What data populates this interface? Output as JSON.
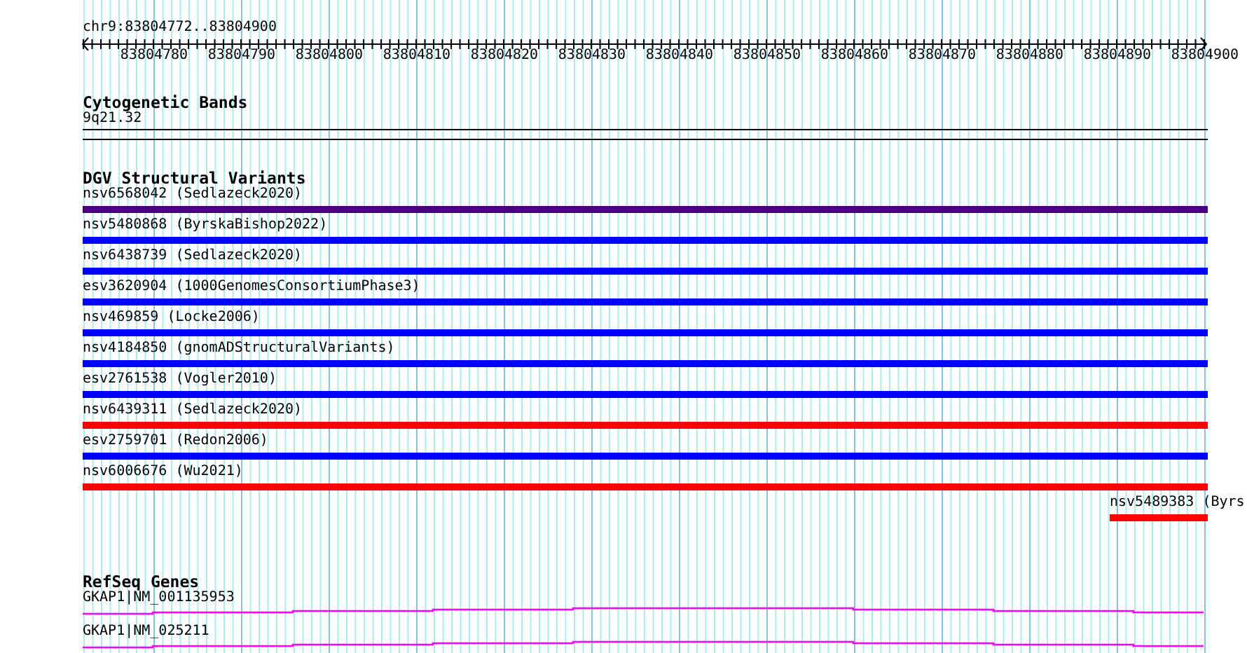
{
  "ruler": {
    "position": "chr9:83804772..83804900",
    "ticks": [
      "83804780",
      "83804790",
      "83804800",
      "83804810",
      "83804820",
      "83804830",
      "83804840",
      "83804850",
      "83804860",
      "83804870",
      "83804880",
      "83804890",
      "83804900"
    ]
  },
  "tracks": [
    {
      "kind": "bands",
      "title": "Cytogenetic Bands",
      "items": [
        {
          "label": "9q21.32"
        }
      ]
    },
    {
      "kind": "variants",
      "title": "DGV Structural Variants",
      "items": [
        {
          "label": "nsv6568042 (Sedlazeck2020)",
          "color": "#4b0082",
          "kind": "full"
        },
        {
          "label": "nsv5480868 (ByrskaBishop2022)",
          "color": "#0000ff",
          "kind": "full"
        },
        {
          "label": "nsv6438739 (Sedlazeck2020)",
          "color": "#0000ff",
          "kind": "full"
        },
        {
          "label": "esv3620904 (1000GenomesConsortiumPhase3)",
          "color": "#0000ff",
          "kind": "full"
        },
        {
          "label": "nsv469859 (Locke2006)",
          "color": "#0000ff",
          "kind": "full"
        },
        {
          "label": "nsv4184850 (gnomADStructuralVariants)",
          "color": "#0000ff",
          "kind": "full"
        },
        {
          "label": "esv2761538 (Vogler2010)",
          "color": "#0000ff",
          "kind": "full"
        },
        {
          "label": "nsv6439311 (Sedlazeck2020)",
          "color": "#ff0000",
          "kind": "full"
        },
        {
          "label": "esv2759701 (Redon2006)",
          "color": "#0000ff",
          "kind": "full"
        },
        {
          "label": "nsv6006676 (Wu2021)",
          "color": "#ff0000",
          "kind": "full"
        },
        {
          "label": "nsv5489383 (Byrs",
          "color": "#ff0000",
          "kind": "right-end"
        }
      ]
    },
    {
      "kind": "genes",
      "title": "RefSeq Genes",
      "items": [
        {
          "label": "GKAP1|NM_001135953"
        },
        {
          "label": "GKAP1|NM_025211"
        }
      ]
    }
  ]
}
